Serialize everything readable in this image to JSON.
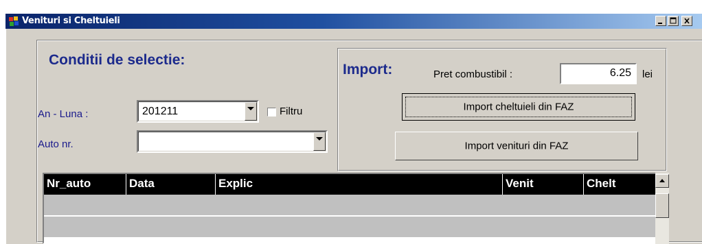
{
  "window": {
    "title": "Venituri si Cheltuieli",
    "controls": [
      "minimize",
      "maximize",
      "close"
    ]
  },
  "selection": {
    "heading": "Conditii de selectie:",
    "an_luna_label": "An - Luna :",
    "an_luna_value": "201211",
    "filter_label": "Filtru",
    "filter_checked": false,
    "auto_label": "Auto nr.",
    "auto_value": ""
  },
  "import": {
    "heading": "Import:",
    "fuel_price_label": "Pret combustibil :",
    "fuel_price_value": "6.25",
    "currency": "lei",
    "btn_expenses": "Import cheltuieli din FAZ",
    "btn_income": "Import venituri din FAZ"
  },
  "grid": {
    "columns": [
      "Nr_auto",
      "Data",
      "Explic",
      "Venit",
      "Chelt"
    ],
    "rows": [
      [
        "",
        "",
        "",
        "",
        ""
      ],
      [
        "",
        "",
        "",
        "",
        ""
      ]
    ]
  }
}
